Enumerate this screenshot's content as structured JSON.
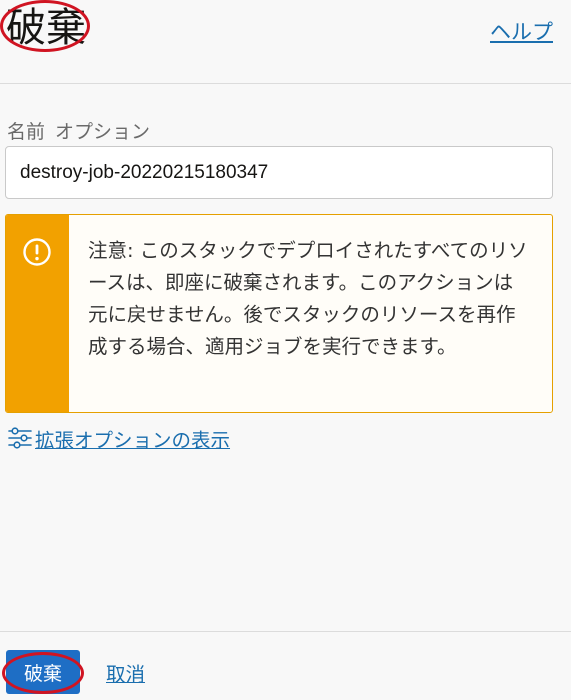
{
  "header": {
    "title": "破棄",
    "help_label": "ヘルプ"
  },
  "form": {
    "name_label": "名前",
    "optional_label": "オプション",
    "name_value": "destroy-job-20220215180347"
  },
  "warning": {
    "text": "注意: このスタックでデプロイされたすべてのリソースは、即座に破棄されます。このアクションは元に戻せません。後でスタックのリソースを再作成する場合、適用ジョブを実行できます。",
    "icon": "exclamation-circle-icon"
  },
  "advanced": {
    "label": "拡張オプションの表示",
    "icon": "sliders-icon"
  },
  "footer": {
    "destroy_label": "破棄",
    "cancel_label": "取消"
  },
  "colors": {
    "primary_button": "#1e6ec5",
    "link": "#1a6eae",
    "warning_accent": "#f2a100",
    "annotation_circle": "#d01422"
  }
}
